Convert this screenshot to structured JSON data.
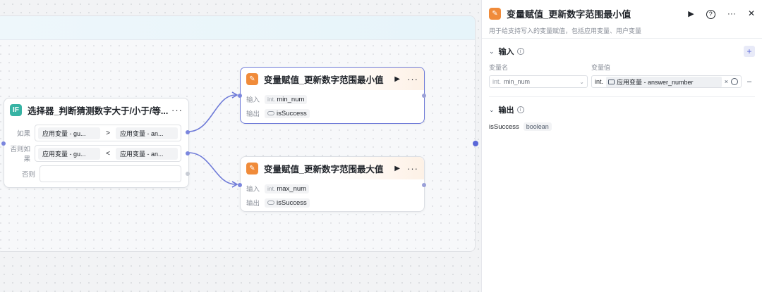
{
  "canvas": {
    "if_node": {
      "title": "选择器_判断猜测数字大于/小于/等...",
      "icon_text": "IF",
      "conditions": [
        {
          "label": "如果",
          "left": "应用变量 - gu...",
          "op": ">",
          "right": "应用变量 - an..."
        },
        {
          "label": "否则如果",
          "left": "应用变量 - gu...",
          "op": "<",
          "right": "应用变量 - an..."
        },
        {
          "label": "否则",
          "left": "",
          "op": "",
          "right": ""
        }
      ]
    },
    "node_min": {
      "title": "变量赋值_更新数字范围最小值",
      "input_label": "输入",
      "input_type": "int.",
      "input_name": "min_num",
      "output_label": "输出",
      "output_name": "isSuccess"
    },
    "node_max": {
      "title": "变量赋值_更新数字范围最大值",
      "input_label": "输入",
      "input_type": "int.",
      "input_name": "max_num",
      "output_label": "输出",
      "output_name": "isSuccess"
    }
  },
  "panel": {
    "title": "变量赋值_更新数字范围最小值",
    "description": "用于给支持写入的变量赋值，包括应用变量、用户变量",
    "input_section": {
      "title": "输入",
      "col_name": "变量名",
      "col_value": "变量值",
      "row": {
        "name_type": "int.",
        "name_value": "min_num",
        "value_type": "int.",
        "value_ref": "应用变量 - answer_number"
      }
    },
    "output_section": {
      "title": "输出",
      "var_name": "isSuccess",
      "var_type": "boolean"
    }
  },
  "icons": {
    "node": "variable-assign-icon",
    "if": "if-selector-icon",
    "play": "play-icon",
    "more": "more-icon",
    "help": "help-icon",
    "close": "close-icon"
  },
  "colors": {
    "accent": "#5a67d8",
    "node_icon": "#f08b3a",
    "if_icon": "#37b3a4"
  }
}
